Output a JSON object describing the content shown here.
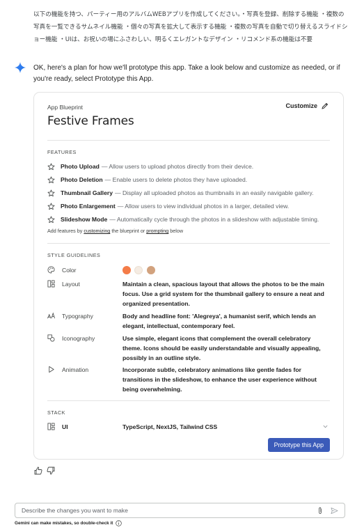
{
  "user_prompt": "以下の機能を持つ、パーティー用のアルバムWEBアプリを作成してください。・写真を登録、削除する機能 ・複数の写真を一覧できるサムネイル機能 ・個々の写真を拡大して表示する機能 ・複数の写真を自動で切り替えるスライドショー機能 ・UIは、お祝いの場にふさわしい、明るくエレガントなデザイン ・リコメンド系の機能は不要",
  "reply": "OK, here's a plan for how we'll prototype this app. Take a look below and customize as needed, or if you're ready, select Prototype this App.",
  "blueprint": {
    "label": "App Blueprint",
    "customize_label": "Customize",
    "title": "Festive Frames",
    "features_heading": "FEATURES",
    "features": [
      {
        "name": "Photo Upload",
        "desc": "— Allow users to upload photos directly from their device."
      },
      {
        "name": "Photo Deletion",
        "desc": "— Enable users to delete photos they have uploaded."
      },
      {
        "name": "Thumbnail Gallery",
        "desc": "— Display all uploaded photos as thumbnails in an easily navigable gallery."
      },
      {
        "name": "Photo Enlargement",
        "desc": "— Allow users to view individual photos in a larger, detailed view."
      },
      {
        "name": "Slideshow Mode",
        "desc": "— Automatically cycle through the photos in a slideshow with adjustable timing."
      }
    ],
    "add_note": {
      "prefix": "Add features by",
      "link1": "customizing",
      "middle": "the blueprint or",
      "link2": "prompting",
      "suffix": "below"
    },
    "style_heading": "STYLE GUIDELINES",
    "style": {
      "color_label": "Color",
      "colors": [
        "#f47c48",
        "#f5ece3",
        "#d2a27e"
      ],
      "layout_label": "Layout",
      "layout_value": "Maintain a clean, spacious layout that allows the photos to be the main focus. Use a grid system for the thumbnail gallery to ensure a neat and organized presentation.",
      "typography_label": "Typography",
      "typography_value": "Body and headline font: 'Alegreya', a humanist serif, which lends an elegant, intellectual, contemporary feel.",
      "iconography_label": "Iconography",
      "iconography_value": "Use simple, elegant icons that complement the overall celebratory theme. Icons should be easily understandable and visually appealing, possibly in an outline style.",
      "animation_label": "Animation",
      "animation_value": "Incorporate subtle, celebratory animations like gentle fades for transitions in the slideshow, to enhance the user experience without being overwhelming."
    },
    "stack_heading": "STACK",
    "stack": {
      "label": "UI",
      "value": "TypeScript, NextJS, Tailwind CSS"
    },
    "prototype_button": "Prototype this App"
  },
  "input": {
    "placeholder": "Describe the changes you want to make"
  },
  "disclaimer": "Gemini can make mistakes, so double-check it",
  "icons": {
    "spark": "gemini-spark-icon",
    "customize": "pencil-icon",
    "feature": "star-icon",
    "color": "palette-icon",
    "layout": "layout-icon",
    "typography": "typography-icon",
    "iconography": "shapes-icon",
    "animation": "play-icon",
    "ui": "layout-icon",
    "expand": "chevron-down-icon",
    "thumbs_up": "thumbs-up-icon",
    "thumbs_down": "thumbs-down-icon",
    "attach": "paperclip-icon",
    "send": "send-icon",
    "info": "info-icon"
  },
  "accent_color": "#3b5bb9"
}
